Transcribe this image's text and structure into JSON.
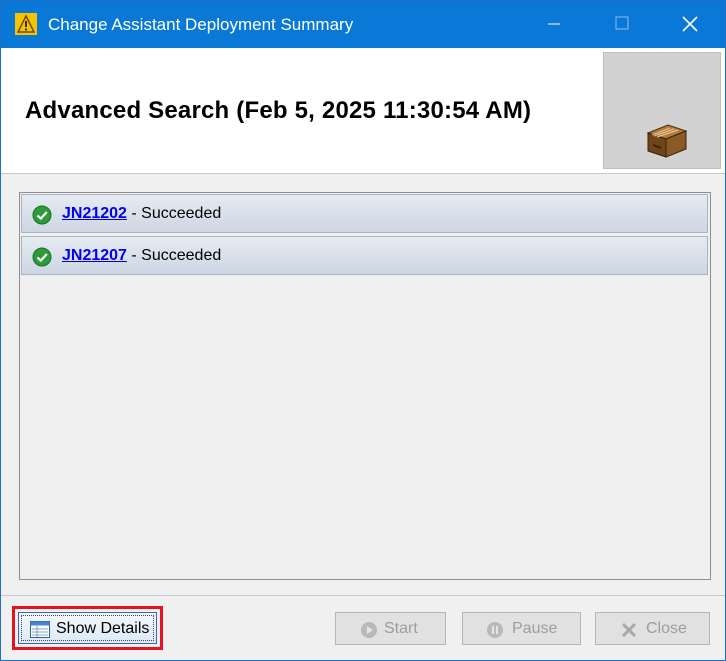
{
  "window": {
    "title": "Change Assistant Deployment Summary",
    "accent_color": "#0a78d7"
  },
  "header": {
    "title": "Advanced Search (Feb 5, 2025 11:30:54 AM)",
    "graphic_icon": "box-icon"
  },
  "items": [
    {
      "id": "JN21202",
      "status": "- Succeeded",
      "status_icon": "check-circle-icon"
    },
    {
      "id": "JN21207",
      "status": "- Succeeded",
      "status_icon": "check-circle-icon"
    }
  ],
  "buttons": {
    "show_details": "Show Details",
    "start": "Start",
    "pause": "Pause",
    "close": "Close"
  }
}
